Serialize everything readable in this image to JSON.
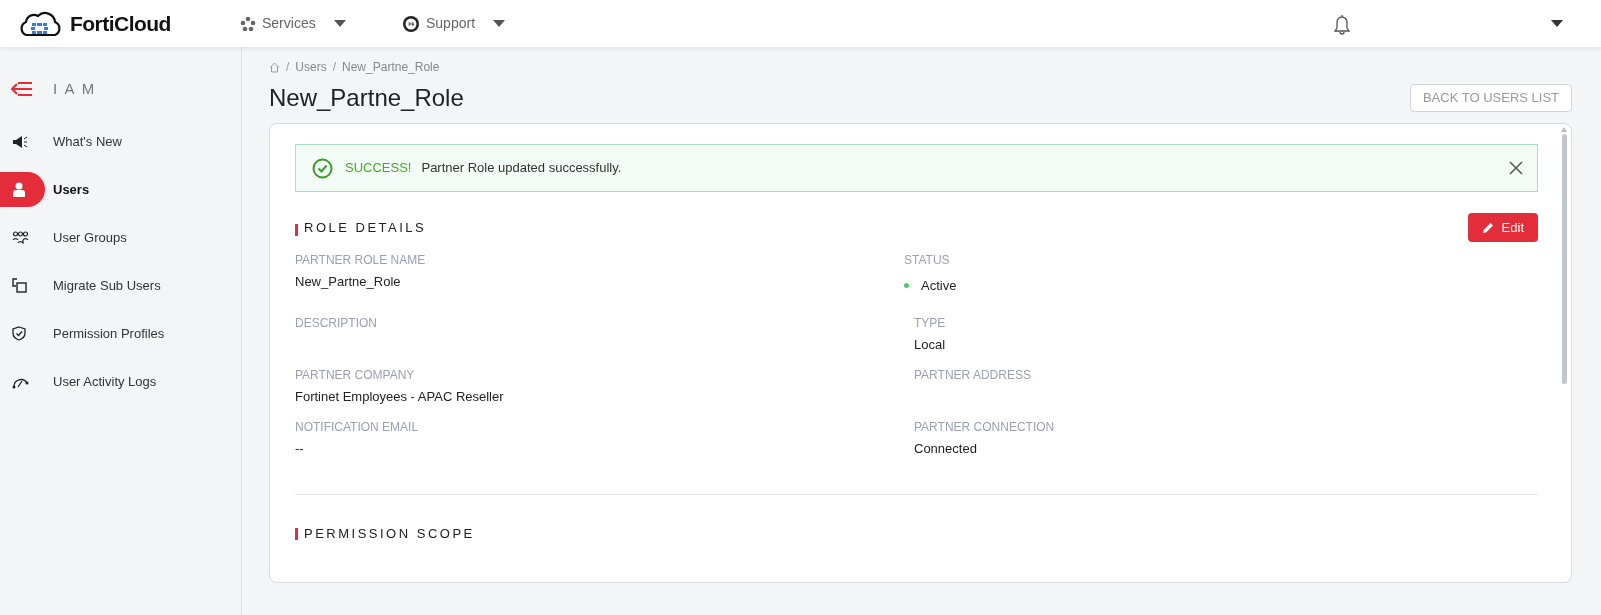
{
  "header": {
    "logo": "FortiCloud",
    "nav": [
      {
        "label": "Services"
      },
      {
        "label": "Support"
      }
    ]
  },
  "sidebar": {
    "title": "I A M",
    "items": [
      {
        "label": "What's New",
        "selected": false
      },
      {
        "label": "Users",
        "selected": true
      },
      {
        "label": "User Groups",
        "selected": false
      },
      {
        "label": "Migrate Sub Users",
        "selected": false
      },
      {
        "label": "Permission Profiles",
        "selected": false
      },
      {
        "label": "User Activity Logs",
        "selected": false
      }
    ]
  },
  "breadcrumb": {
    "separator": "/",
    "items": [
      "Users",
      "New_Partne_Role"
    ]
  },
  "title": "New_Partne_Role",
  "back_button": "BACK TO USERS LIST",
  "alert": {
    "title": "SUCCESS!",
    "message": "Partner Role updated successfully."
  },
  "role_details": {
    "heading": "ROLE DETAILS",
    "edit_button": "Edit",
    "left": [
      {
        "kind": "text",
        "label": "PARTNER ROLE NAME",
        "value": "New_Partne_Role"
      },
      {
        "kind": "text",
        "label": "DESCRIPTION"
      },
      {
        "kind": "text",
        "label": "PARTNER COMPANY",
        "value": "Fortinet Employees - APAC Reseller"
      },
      {
        "kind": "text",
        "label": "NOTIFICATION EMAIL",
        "value": "--"
      }
    ],
    "right": [
      {
        "kind": "status",
        "label": "STATUS",
        "value": "Active",
        "color": "#4ccd6b"
      },
      {
        "kind": "text",
        "label": "TYPE",
        "value": "Local"
      },
      {
        "kind": "text",
        "label": "PARTNER ADDRESS"
      },
      {
        "kind": "text",
        "label": "PARTNER CONNECTION",
        "value": "Connected"
      }
    ]
  },
  "permission_scope": {
    "heading": "PERMISSION SCOPE"
  }
}
